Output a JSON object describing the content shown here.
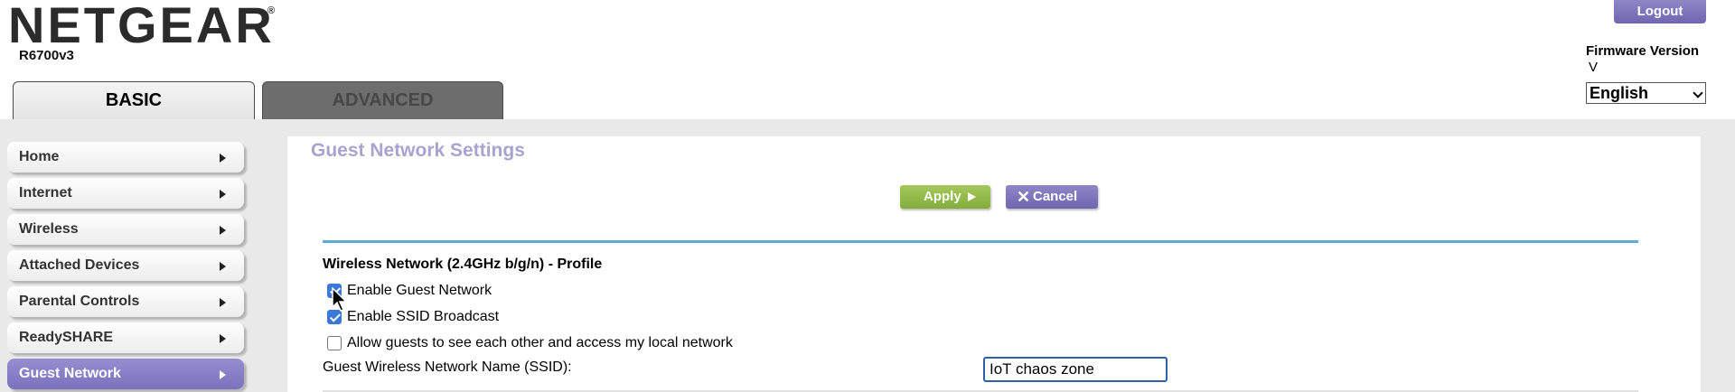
{
  "header": {
    "brand": "NETGEAR",
    "brand_mark": "®",
    "model": "R6700v3",
    "logout_label": "Logout",
    "firmware_label": "Firmware Version",
    "firmware_value": "V",
    "language": "English"
  },
  "tabs": [
    {
      "label": "BASIC",
      "active": true
    },
    {
      "label": "ADVANCED",
      "active": false
    }
  ],
  "sidebar": {
    "items": [
      {
        "label": "Home"
      },
      {
        "label": "Internet"
      },
      {
        "label": "Wireless"
      },
      {
        "label": "Attached Devices"
      },
      {
        "label": "Parental Controls"
      },
      {
        "label": "ReadySHARE"
      },
      {
        "label": "Guest Network",
        "active": true
      }
    ]
  },
  "main": {
    "title": "Guest Network Settings",
    "apply_label": "Apply",
    "cancel_label": "Cancel",
    "section_title": "Wireless Network (2.4GHz b/g/n) - Profile",
    "options": [
      {
        "label": "Enable Guest Network",
        "checked": true
      },
      {
        "label": "Enable SSID Broadcast",
        "checked": true
      },
      {
        "label": "Allow guests to see each other and access my local network",
        "checked": false
      }
    ],
    "ssid_label": "Guest Wireless Network Name (SSID):",
    "ssid_value": "IoT chaos zone"
  },
  "colors": {
    "accent_purple": "#7a72bd",
    "apply_green": "#8db44a",
    "divider_blue": "#5fa9d3",
    "title_lavender": "#a8a3cf"
  },
  "icons": {
    "cancel": "close-icon",
    "apply": "play-arrow-icon",
    "menu_arrow": "triangle-right-icon",
    "pointer": "mouse-cursor-icon"
  }
}
